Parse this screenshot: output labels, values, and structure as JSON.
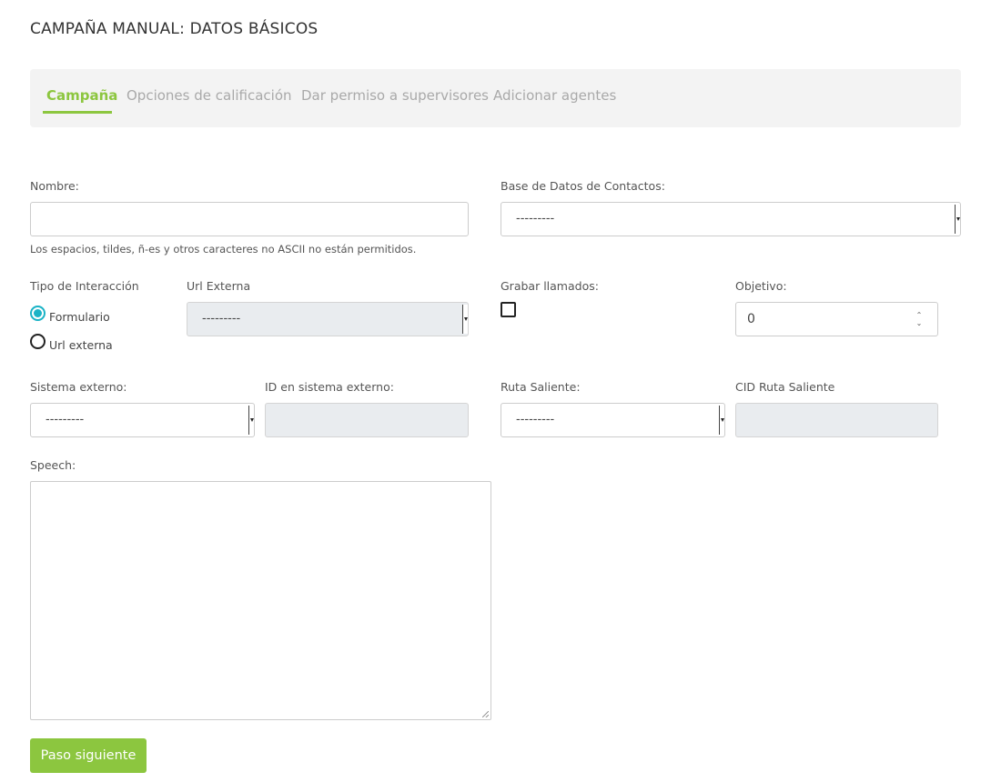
{
  "page": {
    "title": "CAMPAÑA MANUAL: DATOS BÁSICOS"
  },
  "tabs": [
    {
      "label": "Campaña",
      "active": true
    },
    {
      "label": "Opciones de calificación",
      "active": false
    },
    {
      "label": "Dar permiso a supervisores",
      "active": false
    },
    {
      "label": "Adicionar agentes",
      "active": false
    }
  ],
  "form": {
    "nombre": {
      "label": "Nombre:",
      "value": "",
      "help": "Los espacios, tildes, ñ-es y otros caracteres no ASCII no están permitidos."
    },
    "base_datos": {
      "label": "Base de Datos de Contactos:",
      "selected": "---------"
    },
    "tipo_interaccion": {
      "label": "Tipo de Interacción",
      "options": [
        {
          "label": "Formulario",
          "checked": true
        },
        {
          "label": "Url externa",
          "checked": false
        }
      ]
    },
    "url_externa": {
      "label": "Url Externa",
      "selected": "---------"
    },
    "grabar_llamados": {
      "label": "Grabar llamados:",
      "checked": false
    },
    "objetivo": {
      "label": "Objetivo:",
      "value": "0"
    },
    "sistema_externo": {
      "label": "Sistema externo:",
      "selected": "---------"
    },
    "id_sistema_externo": {
      "label": "ID en sistema externo:",
      "value": ""
    },
    "ruta_saliente": {
      "label": "Ruta Saliente:",
      "selected": "---------"
    },
    "cid_ruta_saliente": {
      "label": "CID Ruta Saliente",
      "value": ""
    },
    "speech": {
      "label": "Speech:",
      "value": ""
    }
  },
  "actions": {
    "next_label": "Paso siguiente"
  },
  "colors": {
    "accent": "#8cc63f",
    "radio": "#1ab3c6",
    "tab_inactive": "#a9a9a9",
    "disabled_bg": "#e9ecef"
  }
}
